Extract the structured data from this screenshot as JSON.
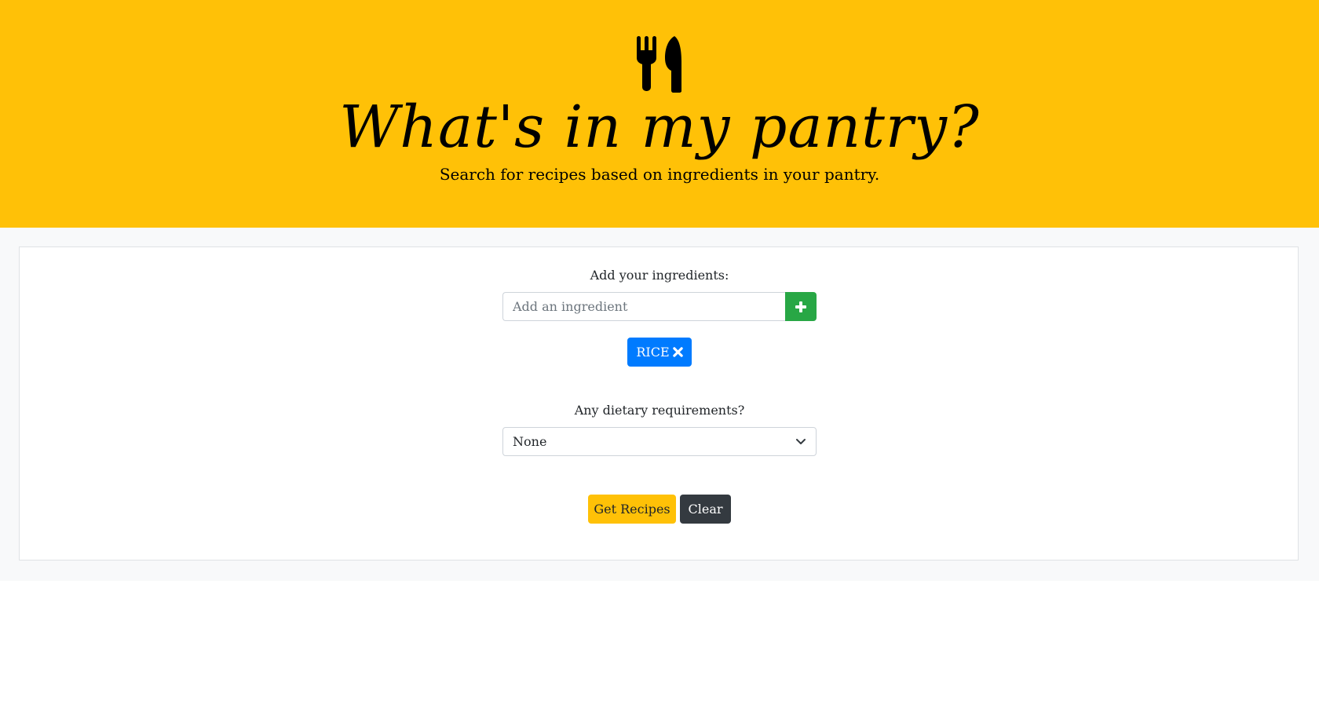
{
  "header": {
    "logo_icon": "utensils-icon",
    "title": "What's in my pantry?",
    "subtitle": "Search for recipes based on ingredients in your pantry."
  },
  "ingredients": {
    "label": "Add your ingredients:",
    "input_placeholder": "Add an ingredient",
    "input_value": "",
    "add_button_icon": "plus-icon",
    "chips": [
      {
        "label": "RICE",
        "remove_icon": "times-icon"
      }
    ]
  },
  "dietary": {
    "label": "Any dietary requirements?",
    "selected": "None",
    "chevron_icon": "chevron-down-icon"
  },
  "actions": {
    "get_recipes_label": "Get Recipes",
    "clear_label": "Clear"
  },
  "colors": {
    "hero_bg": "#ffc107",
    "add_button": "#28a745",
    "chip": "#007bff",
    "get_recipes": "#ffc107",
    "clear": "#343a40"
  }
}
